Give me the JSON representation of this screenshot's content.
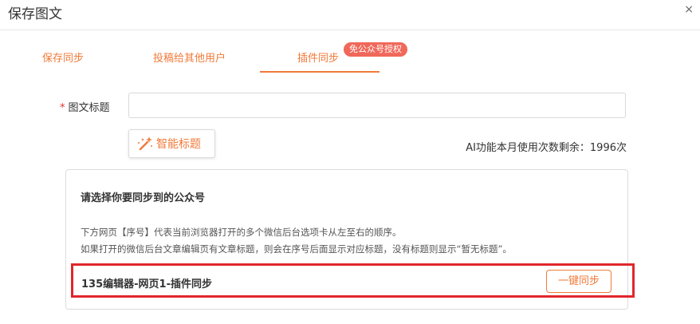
{
  "dialog": {
    "title": "保存图文",
    "close_glyph": "×"
  },
  "tabs": [
    {
      "label": "保存同步",
      "active": false
    },
    {
      "label": "投稿给其他用户",
      "active": false
    },
    {
      "label": "插件同步",
      "active": true,
      "badge": "免公众号授权"
    }
  ],
  "form": {
    "required_mark": "*",
    "title_label": "图文标题",
    "title_value": "",
    "title_placeholder": ""
  },
  "smart_title": {
    "label": "智能标题",
    "icon": "magic-wand-icon"
  },
  "ai_quota_text": "AI功能本月使用次数剩余：1996次",
  "panel": {
    "heading": "请选择你要同步到的公众号",
    "desc_line1": "下方网页【序号】代表当前浏览器打开的多个微信后台选项卡从左至右的顺序。",
    "desc_line2": "如果打开的微信后台文章编辑页有文章标题，则会在序号后面显示对应标题，没有标题则显示“暂无标题”。",
    "row_label": "135编辑器-网页1-插件同步",
    "sync_button": "一键同步"
  },
  "colors": {
    "accent": "#f07a3a",
    "badge": "#f0685a",
    "highlight": "#e0262b"
  }
}
